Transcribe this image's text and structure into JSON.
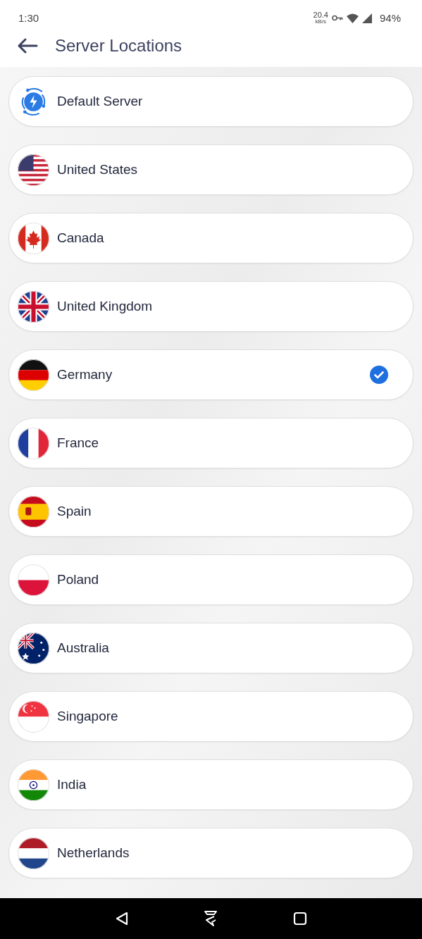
{
  "status_bar": {
    "time": "1:30",
    "speed": "20.4",
    "speed_unit": "kB/s",
    "battery": "94%"
  },
  "header": {
    "title": "Server Locations"
  },
  "servers": [
    {
      "name": "Default Server",
      "kind": "bolt",
      "selected": false
    },
    {
      "name": "United States",
      "kind": "us",
      "selected": false
    },
    {
      "name": "Canada",
      "kind": "ca",
      "selected": false
    },
    {
      "name": "United Kingdom",
      "kind": "gb",
      "selected": false
    },
    {
      "name": "Germany",
      "kind": "de",
      "selected": true
    },
    {
      "name": "France",
      "kind": "fr",
      "selected": false
    },
    {
      "name": "Spain",
      "kind": "es",
      "selected": false
    },
    {
      "name": "Poland",
      "kind": "pl",
      "selected": false
    },
    {
      "name": "Australia",
      "kind": "au",
      "selected": false
    },
    {
      "name": "Singapore",
      "kind": "sg",
      "selected": false
    },
    {
      "name": "India",
      "kind": "in",
      "selected": false
    },
    {
      "name": "Netherlands",
      "kind": "nl",
      "selected": false
    }
  ]
}
